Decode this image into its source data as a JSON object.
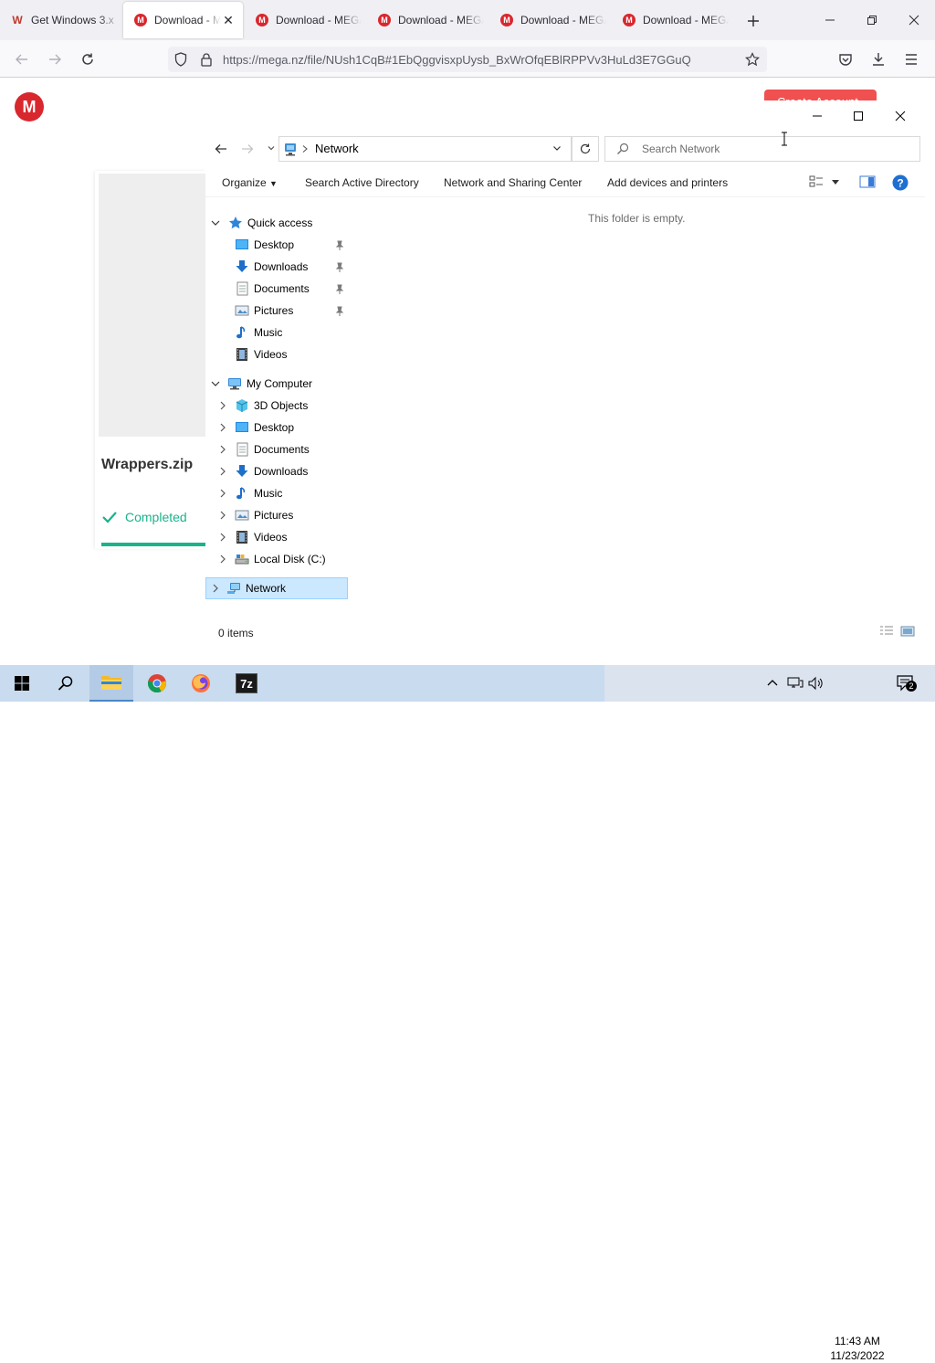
{
  "browser": {
    "tabs": [
      {
        "label": "Get Windows 3.x",
        "favicon": "W"
      },
      {
        "label": "Download - MEGA",
        "favicon": "M",
        "active": true
      },
      {
        "label": "Download - MEGA",
        "favicon": "M"
      },
      {
        "label": "Download - MEGA",
        "favicon": "M"
      },
      {
        "label": "Download - MEGA",
        "favicon": "M"
      },
      {
        "label": "Download - MEGA",
        "favicon": "M"
      }
    ],
    "url": "https://mega.nz/file/NUsh1CqB#1EbQggvisxpUysb_BxWrOfqEBlRPPVv3HuLd3E7GGuQ"
  },
  "mega": {
    "logo_letter": "M",
    "create_account_label": "Create Account",
    "filename": "Wrappers.zip",
    "status": "Completed",
    "progress": 1.0,
    "accent_color": "#19b38b"
  },
  "explorer": {
    "address": "Network",
    "search_placeholder": "Search Network",
    "commands": [
      "Organize",
      "Search Active Directory",
      "Network and Sharing Center",
      "Add devices and printers"
    ],
    "empty_message": "This folder is empty.",
    "status_items": "0 items",
    "tree": {
      "quick_access": {
        "label": "Quick access",
        "items": [
          {
            "label": "Desktop",
            "icon": "desktop-icon",
            "pinned": true
          },
          {
            "label": "Downloads",
            "icon": "downloads-icon",
            "pinned": true
          },
          {
            "label": "Documents",
            "icon": "documents-icon",
            "pinned": true
          },
          {
            "label": "Pictures",
            "icon": "pictures-icon",
            "pinned": true
          },
          {
            "label": "Music",
            "icon": "music-icon",
            "pinned": false
          },
          {
            "label": "Videos",
            "icon": "videos-icon",
            "pinned": false
          }
        ]
      },
      "my_computer": {
        "label": "My Computer",
        "items": [
          {
            "label": "3D Objects",
            "icon": "3d-objects-icon"
          },
          {
            "label": "Desktop",
            "icon": "desktop-icon"
          },
          {
            "label": "Documents",
            "icon": "documents-icon"
          },
          {
            "label": "Downloads",
            "icon": "downloads-icon"
          },
          {
            "label": "Music",
            "icon": "music-icon"
          },
          {
            "label": "Pictures",
            "icon": "pictures-icon"
          },
          {
            "label": "Videos",
            "icon": "videos-icon"
          },
          {
            "label": "Local Disk (C:)",
            "icon": "local-disk-icon"
          }
        ]
      },
      "network": {
        "label": "Network",
        "selected": true
      }
    }
  },
  "taskbar": {
    "apps": [
      "file-explorer-icon",
      "chrome-icon",
      "firefox-icon",
      "7zip-icon"
    ],
    "sevenzip_label": "7z",
    "time": "11:43 AM",
    "date": "11/23/2022",
    "notification_count": "2"
  }
}
